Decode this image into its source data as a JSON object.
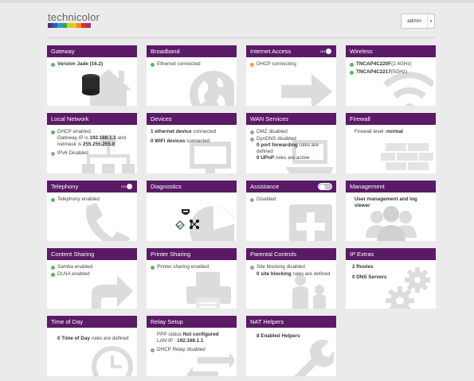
{
  "brand": {
    "name": "technicolor",
    "bar_colors": [
      "#5b2a86",
      "#2a62b8",
      "#2a9ad6",
      "#33a852",
      "#c7d22a",
      "#f0c419",
      "#f08a1c",
      "#e0322a",
      "#b0296d"
    ]
  },
  "user_menu": {
    "name": "admin",
    "caret": "▾"
  },
  "colors": {
    "header": "#5a1a66",
    "green": "#5cb85c",
    "orange": "#f0a030",
    "grey": "#a0a0a0"
  },
  "cards": {
    "gateway": {
      "title": "Gateway",
      "version": "Version Jade (16.2)"
    },
    "broadband": {
      "title": "Broadband",
      "status": "Ethernet connected"
    },
    "internet": {
      "title": "Internet Access",
      "toggle": "ON",
      "status": "DHCP connecting"
    },
    "wireless": {
      "title": "Wireless",
      "ssid1": "TNCAP4C220F",
      "band1": "(2.4GHz)",
      "ssid2": "TNCAP4C2217",
      "band2": "(5GHz)"
    },
    "local": {
      "title": "Local Network",
      "dhcp": "DHCP enabled",
      "ip_prefix": "Gateway IP is ",
      "ip": "192.168.1.1",
      "ip_mid": " and netmask is ",
      "netmask": "255.255.255.0",
      "ipv6": "IPv6 Disabled"
    },
    "devices": {
      "title": "Devices",
      "eth_count": "1 ethernet device",
      "eth_suffix": " connected",
      "wifi_count": "0 WiFi devices",
      "wifi_suffix": " connected"
    },
    "wan": {
      "title": "WAN Services",
      "dmz": "DMZ disabled",
      "ddns": "DynDNS disabled",
      "pf_count": "0 port forwarding",
      "pf_suffix": " rules are defined",
      "upnp_count": "0 UPnP",
      "upnp_suffix": " rules are active"
    },
    "firewall": {
      "title": "Firewall",
      "label": "Firewall level: ",
      "level": "normal"
    },
    "telephony": {
      "title": "Telephony",
      "toggle": "ON",
      "status": "Telephony enabled"
    },
    "diagnostics": {
      "title": "Diagnostics"
    },
    "assistance": {
      "title": "Assistance",
      "toggle": "OFF",
      "status": "Disabled"
    },
    "management": {
      "title": "Management",
      "text": "User management and log viewer"
    },
    "content": {
      "title": "Content Sharing",
      "samba": "Samba enabled",
      "dlna": "DLNA enabled"
    },
    "printer": {
      "title": "Printer Sharing",
      "status": "Printer sharing enabled"
    },
    "parental": {
      "title": "Parental Controls",
      "status": "Site blocking disabled",
      "count": "0 site blocking",
      "suffix": " rules are defined"
    },
    "ipextras": {
      "title": "IP Extras",
      "routes": "2 Routes",
      "dns": "0 DNS Servers"
    },
    "timeofday": {
      "title": "Time of Day",
      "count": "0 Time of Day",
      "suffix": " rules are defined"
    },
    "relay": {
      "title": "Relay Setup",
      "ppp_label": "PPP status ",
      "ppp_value": "Not configured",
      "lan_label": "LAN IP : ",
      "lan_ip": "192.168.1.1",
      "dhcp_relay": "DHCP Relay disabled"
    },
    "nat": {
      "title": "NAT Helpers",
      "text": "8 Enabled Helpers"
    }
  }
}
